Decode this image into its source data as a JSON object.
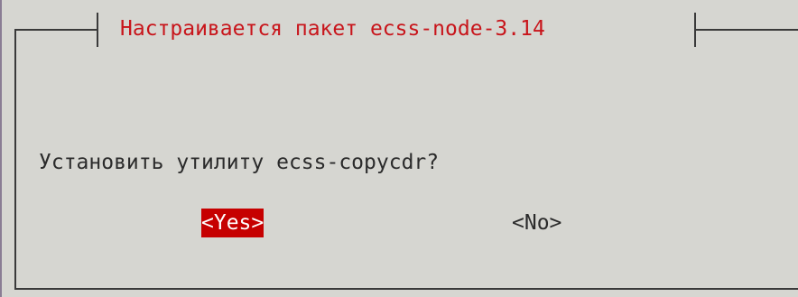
{
  "dialog": {
    "title": "Настраивается пакет ecss-node-3.14",
    "question": "Установить утилиту ecss-copycdr?",
    "buttons": {
      "yes": "<Yes>",
      "no": "<No>"
    },
    "selected_button": "yes"
  },
  "colors": {
    "background": "#d6d6d1",
    "title_text": "#c8151b",
    "selected_button_bg": "#c60000",
    "selected_button_text": "#ffffff",
    "body_text": "#2b2b2b",
    "frame": "#3a3a3a"
  }
}
